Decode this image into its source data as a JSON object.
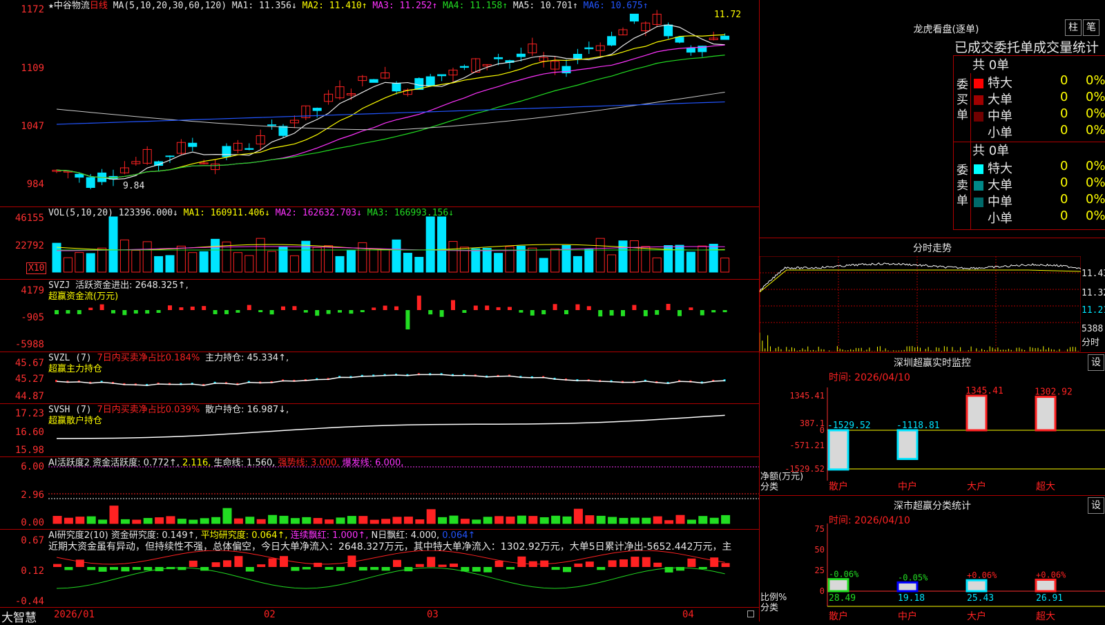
{
  "app": {
    "brand": "大智慧"
  },
  "colors": {
    "up": "#ff2222",
    "down": "#00e5ff",
    "grid": "#b00000",
    "ma1": "#e8e8e8",
    "ma2": "#ffff00",
    "ma3": "#ff33ff",
    "ma4": "#22dd22",
    "ma5": "#2255ff",
    "ma6": "#cccccc"
  },
  "kline": {
    "title": "中谷物流",
    "period": "日线",
    "ma_label": "MA(5,10,20,30,60,120)",
    "ma1": "MA1: 11.356↓",
    "ma2": "MA2: 11.410↑",
    "ma3": "MA3: 11.252↑",
    "ma4": "MA4: 11.158↑",
    "ma5": "MA5: 10.701↑",
    "ma6": "MA6: 10.675↑",
    "y_labels": [
      "1172",
      "1109",
      "1047",
      "984"
    ],
    "high_note": "11.72",
    "low_note": "9.84"
  },
  "vol": {
    "label": "VOL(5,10,20)",
    "val": "123396.000↓",
    "ma1": "MA1: 160911.406↓",
    "ma2": "MA2: 162632.703↓",
    "ma3": "MA3: 166993.156↓",
    "y_labels": [
      "46155",
      "22792"
    ],
    "unit": "X10"
  },
  "svzj": {
    "label": "SVZJ",
    "title": "活跃资金进出: 2648.325↑,",
    "subtitle": "超赢资金流(万元)",
    "y_labels": [
      "4179",
      "-905",
      "-5988"
    ]
  },
  "svzl": {
    "label": "SVZL (7)",
    "t1": "7日内买卖净占比0.184%",
    "t2": "主力持仓: 45.334↑,",
    "subtitle": "超赢主力持仓",
    "y_labels": [
      "45.67",
      "45.27",
      "44.87"
    ]
  },
  "svsh": {
    "label": "SVSH (7)",
    "t1": "7日内买卖净占比0.039%",
    "t2": "散户持仓: 16.987↓,",
    "subtitle": "超赢散户持仓",
    "y_labels": [
      "17.23",
      "16.60",
      "15.98"
    ]
  },
  "ai1": {
    "label": "AI活跃度2 资金活跃度: 0.772↑,",
    "v2": "2.116,",
    "v3": "生命线: 1.560,",
    "v4": "强势线: 3.000,",
    "v5": "爆发线: 6.000,",
    "y_labels": [
      "6.00",
      "2.96",
      "0.00"
    ]
  },
  "ai2": {
    "label": "AI研究度2(10) 资金研究度: 0.149↑,",
    "v2": "平均研究度: 0.064↑,",
    "v3": "连续飘红: 1.000↑,",
    "v4": "N日飘红: 4.000,",
    "v5": "0.064↑",
    "comment": "近期大资金虽有异动，但持续性不强，总体偏空，今日大单净流入：2648.327万元，其中特大单净流入：1302.92万元，大单5日累计净出-5652.442万元，主",
    "y_labels": [
      "0.67",
      "0.12",
      "-0.44"
    ]
  },
  "xaxis": [
    "2026/01",
    "02",
    "03",
    "04"
  ],
  "longhu": {
    "title": "龙虎看盘(逐单)",
    "btn1": "柱",
    "btn2": "笔",
    "subtitle": "已成交委托单成交量统计",
    "buy": {
      "side": "委买单",
      "total": "共 0单",
      "rows": [
        {
          "name": "特大",
          "v": "0",
          "p": "0%"
        },
        {
          "name": "大单",
          "v": "0",
          "p": "0%"
        },
        {
          "name": "中单",
          "v": "0",
          "p": "0%"
        },
        {
          "name": "小单",
          "v": "0",
          "p": "0%"
        }
      ]
    },
    "sell": {
      "side": "委卖单",
      "total": "共 0单",
      "rows": [
        {
          "name": "特大",
          "v": "0",
          "p": "0%"
        },
        {
          "name": "大单",
          "v": "0",
          "p": "0%"
        },
        {
          "name": "中单",
          "v": "0",
          "p": "0%"
        },
        {
          "name": "小单",
          "v": "0",
          "p": "0%"
        }
      ]
    }
  },
  "minute": {
    "title": "分时走势",
    "y_labels": [
      "11.43",
      "11.32",
      "11.21",
      "5388",
      "分时"
    ]
  },
  "sz_monitor": {
    "title": "深圳超赢实时监控",
    "btn": "设",
    "date": "时间: 2026/04/10",
    "y_labels": [
      "1345.41",
      "387.1",
      "0",
      "-571.21",
      "-1529.52"
    ],
    "axis_title1": "净额(万元)",
    "axis_title2": "分类",
    "bars": [
      {
        "cat": "散户",
        "value": -1529.52,
        "label": "-1529.52"
      },
      {
        "cat": "中户",
        "value": -1118.81,
        "label": "-1118.81"
      },
      {
        "cat": "大户",
        "value": 1345.41,
        "label": "1345.41"
      },
      {
        "cat": "超大",
        "value": 1302.92,
        "label": "1302.92"
      }
    ]
  },
  "sz_class": {
    "title": "深市超赢分类统计",
    "btn": "设",
    "date": "时间: 2026/04/10",
    "y_labels": [
      "75",
      "50",
      "25",
      "0"
    ],
    "axis_title1": "比例%",
    "axis_title2": "分类",
    "bars": [
      {
        "cat": "散户",
        "value": 28.49,
        "top": "-0.06%",
        "label": "28.49"
      },
      {
        "cat": "中户",
        "value": 19.18,
        "top": "-0.05%",
        "label": "19.18"
      },
      {
        "cat": "大户",
        "value": 25.43,
        "top": "+0.06%",
        "label": "25.43"
      },
      {
        "cat": "超大",
        "value": 26.91,
        "top": "+0.06%",
        "label": "26.91"
      }
    ]
  }
}
